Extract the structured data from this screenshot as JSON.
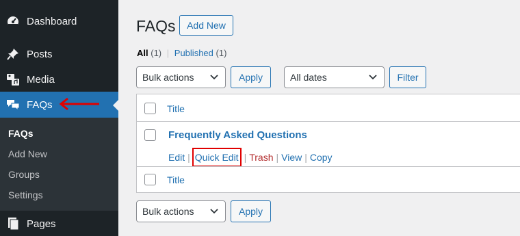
{
  "sidebar": {
    "items": [
      {
        "label": "Dashboard",
        "icon": "dashboard-icon"
      },
      {
        "label": "Posts",
        "icon": "pin-icon"
      },
      {
        "label": "Media",
        "icon": "media-icon"
      },
      {
        "label": "FAQs",
        "icon": "faq-bubbles-icon",
        "active": true
      },
      {
        "label": "Pages",
        "icon": "pages-icon"
      }
    ],
    "submenu": [
      "FAQs",
      "Add New",
      "Groups",
      "Settings"
    ],
    "accent_color": "#2271b1"
  },
  "header": {
    "title": "FAQs",
    "add_new": "Add New"
  },
  "filters": {
    "all_label": "All",
    "all_count": "(1)",
    "published_label": "Published",
    "published_count": "(1)"
  },
  "toolbar": {
    "bulk_actions": "Bulk actions",
    "apply": "Apply",
    "dates": "All dates",
    "filter": "Filter"
  },
  "table": {
    "header_title": "Title",
    "footer_title": "Title",
    "rows": [
      {
        "title": "Frequently Asked Questions",
        "actions": [
          "Edit",
          "Quick Edit",
          "Trash",
          "View",
          "Copy"
        ]
      }
    ]
  },
  "annotation_color": "#e00000"
}
